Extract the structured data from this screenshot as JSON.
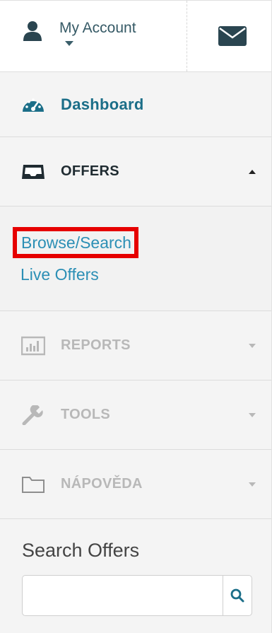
{
  "header": {
    "account_label": "My Account",
    "account_icon": "user-icon",
    "mail_icon": "envelope-icon"
  },
  "nav": {
    "dashboard": {
      "label": "Dashboard",
      "icon": "dashboard-gauge-icon"
    },
    "offers": {
      "label": "OFFERS",
      "icon": "inbox-tray-icon",
      "expanded": true,
      "items": [
        {
          "label": "Browse/Search",
          "highlighted": true
        },
        {
          "label": "Live Offers",
          "highlighted": false
        }
      ]
    },
    "reports": {
      "label": "REPORTS",
      "icon": "bar-chart-icon"
    },
    "tools": {
      "label": "TOOLS",
      "icon": "wrench-icon"
    },
    "help": {
      "label": "NÁPOVĚDA",
      "icon": "folder-icon"
    }
  },
  "search": {
    "title": "Search Offers",
    "value": "",
    "placeholder": "",
    "button_icon": "search-icon"
  },
  "colors": {
    "accent": "#1b6e88",
    "link": "#2c8fb5",
    "highlight_border": "#e60000",
    "muted": "#b8b8b8",
    "icon_dark": "#2a4550"
  }
}
